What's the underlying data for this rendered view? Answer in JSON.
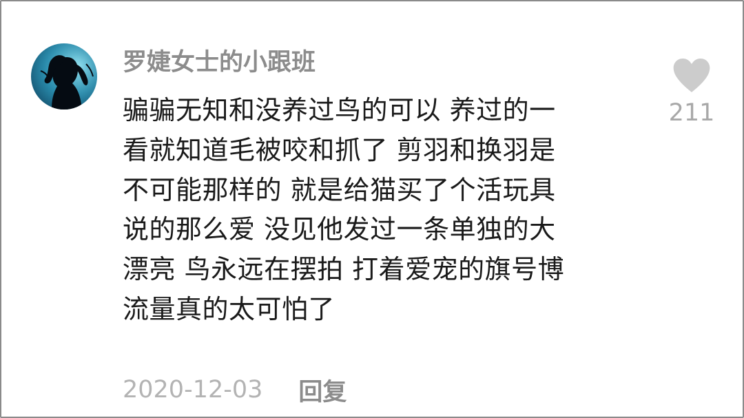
{
  "comment": {
    "username": "罗婕女士的小跟班",
    "lines": [
      "骗骗无知和没养过鸟的可以 养过的一",
      "看就知道毛被咬和抓了 剪羽和换羽是",
      "不可能那样的 就是给猫买了个活玩具",
      "说的那么爱 没见他发过一条单独的大",
      "漂亮 鸟永远在摆拍 打着爱宠的旗号博",
      "流量真的太可怕了"
    ],
    "date": "2020-12-03",
    "reply_label": "回复",
    "like_count": "211",
    "like_icon": "heart-icon",
    "avatar_icon": "silhouette-avatar"
  },
  "colors": {
    "username": "#8c8c8c",
    "text": "#1a1a1a",
    "date": "#b3b3b3",
    "like": "#cccccc"
  }
}
